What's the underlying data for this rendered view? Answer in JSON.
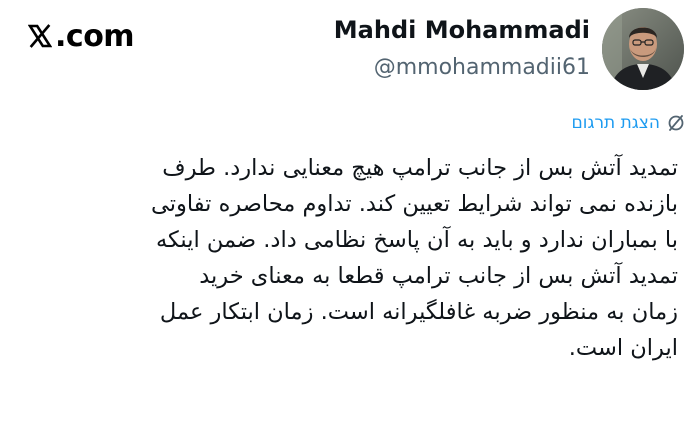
{
  "brand": {
    "domain": "com"
  },
  "author": {
    "name": "Mahdi Mohammadi",
    "handle": "@mmohammadii61"
  },
  "translation": {
    "label": "הצגת תרגום",
    "icon": "translate-icon"
  },
  "tweet": {
    "lines": [
      "تمدید آتش بس از جانب ترامپ هیچ معنایی ندارد. طرف",
      "بازنده نمی تواند شرایط تعیین کند. تداوم محاصره تفاوتی",
      "با بمباران ندارد و باید به آن پاسخ نظامی داد. ضمن اینکه",
      "تمدید آتش بس از جانب ترامپ قطعا به معنای خرید",
      "زمان به منظور ضربه غافلگیرانه است. زمان ابتکار عمل",
      "ایران است."
    ]
  },
  "colors": {
    "link": "#1d9bf0",
    "text": "#0f1419",
    "muted": "#536471"
  }
}
